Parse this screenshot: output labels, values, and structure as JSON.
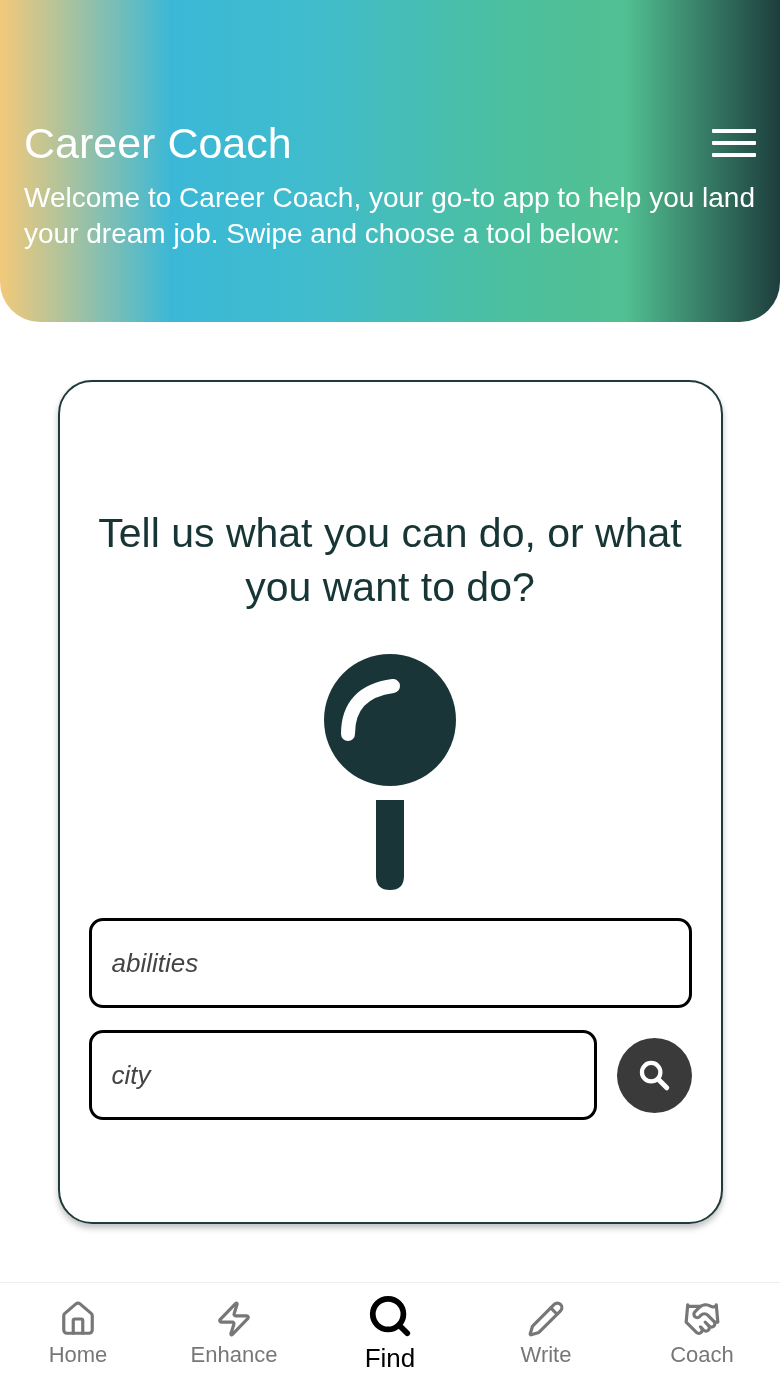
{
  "header": {
    "title": "Career Coach",
    "intro": "Welcome to Career Coach, your go-to app to help you land your dream job. Swipe and choose a tool below:"
  },
  "card": {
    "question": "Tell us what you can do, or what you want to do?",
    "fields": [
      {
        "placeholder": "abilities"
      },
      {
        "placeholder": "city"
      }
    ]
  },
  "nav": [
    {
      "label": "Home",
      "kind": "home",
      "selected": false
    },
    {
      "label": "Enhance",
      "kind": "enhance",
      "selected": false
    },
    {
      "label": "Find",
      "kind": "find",
      "selected": true
    },
    {
      "label": "Write",
      "kind": "write",
      "selected": false
    },
    {
      "label": "Coach",
      "kind": "coach",
      "selected": false
    }
  ]
}
